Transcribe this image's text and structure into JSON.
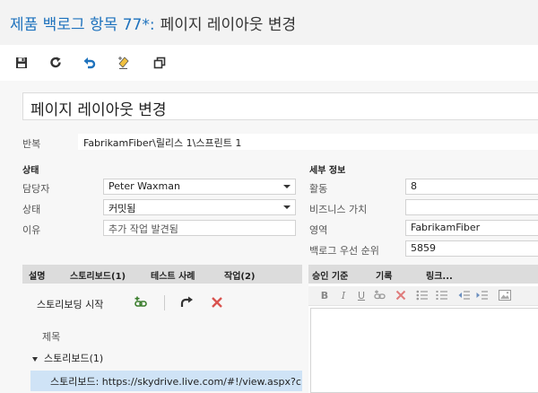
{
  "header": {
    "item_ref": "제품 백로그 항목 77*:",
    "item_name": "페이지 레이아웃 변경"
  },
  "toolbar": {
    "icons": [
      "save-icon",
      "refresh-icon",
      "undo-icon",
      "clear-formatting-icon",
      "copy-icon"
    ]
  },
  "form": {
    "title": "페이지 레이아웃 변경",
    "iteration_label": "반복",
    "iteration_value": "FabrikamFiber\\릴리스 1\\스프린트 1",
    "status_section": "상태",
    "assigned_label": "담당자",
    "assigned_value": "Peter Waxman",
    "state_label": "상태",
    "state_value": "커밋됨",
    "reason_label": "이유",
    "reason_value": "추가 작업 발견됨",
    "details_section": "세부 정보",
    "activity_label": "활동",
    "activity_value": "8",
    "business_value_label": "비즈니스 가치",
    "business_value_value": "",
    "area_label": "영역",
    "area_value": "FabrikamFiber",
    "backlog_priority_label": "백로그 우선 순위",
    "backlog_priority_value": "5859"
  },
  "left_tabs": [
    "설명",
    "스토리보드(1)",
    "테스트 사례",
    "작업(2)"
  ],
  "right_tabs": [
    "승인 기준",
    "기록",
    "링크..."
  ],
  "storyboard": {
    "start_label": "스토리보딩 시작",
    "column_header": "제목",
    "group_label": "스토리보드(1)",
    "item": "스토리보드: https://skydrive.live.com/#!/view.aspx?c..."
  },
  "editor": {
    "buttons": [
      "B",
      "I",
      "U"
    ]
  },
  "colors": {
    "accent": "#1e72bd",
    "delete": "#d9534f",
    "selected_row": "#cfe3f6"
  }
}
